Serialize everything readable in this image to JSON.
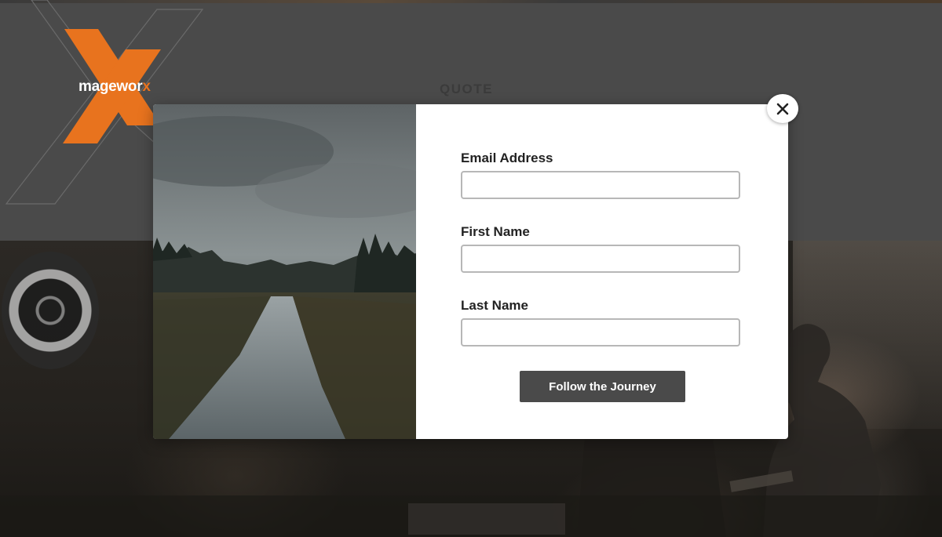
{
  "brand": {
    "logo_text_main": "magewor",
    "logo_text_accent": "x",
    "accent_color": "#e8731e"
  },
  "page": {
    "section_title": "QUOTE"
  },
  "modal": {
    "image_description_icon": "landscape-image",
    "email_label": "Email Address",
    "email_value": "",
    "first_name_label": "First Name",
    "first_name_value": "",
    "last_name_label": "Last Name",
    "last_name_value": "",
    "submit_label": "Follow the Journey",
    "close_icon": "close-icon"
  },
  "colors": {
    "page_background": "#4a4a4a",
    "modal_background": "#ffffff",
    "button_background": "#4a4a4a",
    "input_border": "#b7b7b7"
  }
}
